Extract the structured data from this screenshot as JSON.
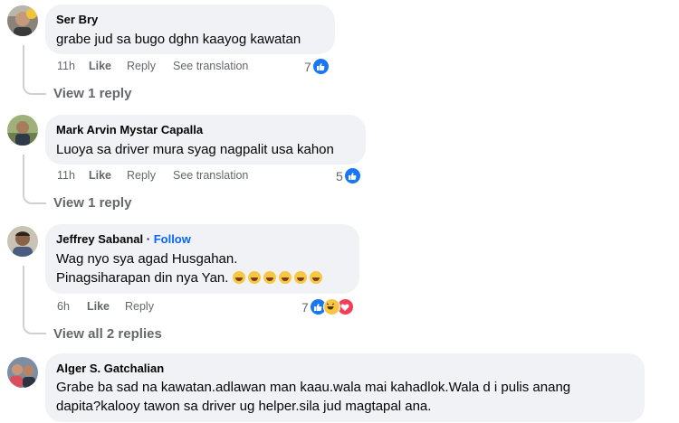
{
  "comments": [
    {
      "author": "Ser Bry",
      "text_lines": [
        "grabe jud sa bugo dghn kaayog kawatan"
      ],
      "time": "11h",
      "like": "Like",
      "reply": "Reply",
      "translate": "See translation",
      "reaction_count": "7",
      "reactions": [
        "like-icon"
      ],
      "replies_link": "View 1 reply"
    },
    {
      "author": "Mark Arvin Mystar Capalla",
      "text_lines": [
        "Luoya sa driver mura syag nagpalit usa kahon"
      ],
      "time": "11h",
      "like": "Like",
      "reply": "Reply",
      "translate": "See translation",
      "reaction_count": "5",
      "reactions": [
        "like-icon"
      ],
      "replies_link": "View 1 reply"
    },
    {
      "author": "Jeffrey Sabanal",
      "follow_sep": "·",
      "follow": "Follow",
      "text_lines": [
        "Wag nyo sya agad Husgahan.",
        "Pinagsiharapan din nya Yan."
      ],
      "emoji_count": 6,
      "time": "6h",
      "like": "Like",
      "reply": "Reply",
      "reaction_count": "7",
      "reactions": [
        "like-icon",
        "haha-icon",
        "love-icon"
      ],
      "replies_link": "View all 2 replies"
    },
    {
      "author": "Alger S. Gatchalian",
      "text_lines": [
        "Grabe ba sad na kawatan.adlawan man kaau.wala mai kahadlok.Wala d i pulis anang",
        "dapita?kalooy tawon sa driver ug helper.sila jud magtapal ana."
      ]
    }
  ],
  "colors": {
    "bubble": "#f0f2f5",
    "secondary_text": "#65676b",
    "follow": "#0866ff",
    "like_blue": "#1877f2",
    "thread_line": "#ced0d4"
  }
}
